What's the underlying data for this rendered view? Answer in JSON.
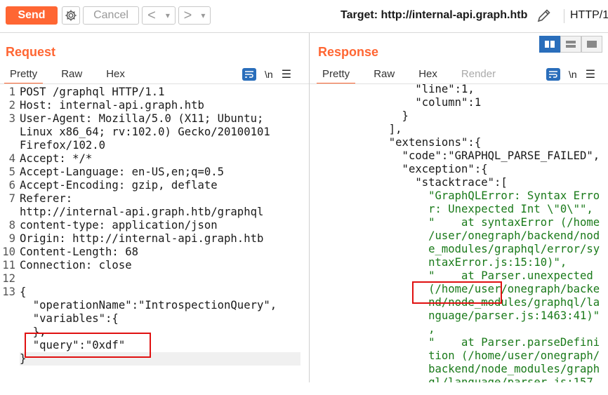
{
  "toolbar": {
    "send_label": "Send",
    "cancel_label": "Cancel",
    "back_label": "<",
    "forward_label": ">",
    "dropdown_glyph": "▾",
    "target_label": "Target: http://internal-api.graph.htb",
    "protocol_label": "HTTP/1"
  },
  "request": {
    "title": "Request",
    "tabs": [
      "Pretty",
      "Raw",
      "Hex"
    ],
    "newline_toggle": "\\n",
    "lines": [
      {
        "n": "1",
        "text": "POST /graphql HTTP/1.1"
      },
      {
        "n": "2",
        "text": "Host: internal-api.graph.htb"
      },
      {
        "n": "3",
        "text": "User-Agent: Mozilla/5.0 (X11; Ubuntu;"
      },
      {
        "n": "",
        "text": "Linux x86_64; rv:102.0) Gecko/20100101"
      },
      {
        "n": "",
        "text": "Firefox/102.0"
      },
      {
        "n": "4",
        "text": "Accept: */*"
      },
      {
        "n": "5",
        "text": "Accept-Language: en-US,en;q=0.5"
      },
      {
        "n": "6",
        "text": "Accept-Encoding: gzip, deflate"
      },
      {
        "n": "7",
        "text": "Referer:"
      },
      {
        "n": "",
        "text": "http://internal-api.graph.htb/graphql"
      },
      {
        "n": "8",
        "text": "content-type: application/json"
      },
      {
        "n": "9",
        "text": "Origin: http://internal-api.graph.htb"
      },
      {
        "n": "10",
        "text": "Content-Length: 68"
      },
      {
        "n": "11",
        "text": "Connection: close"
      },
      {
        "n": "12",
        "text": ""
      },
      {
        "n": "13",
        "text": "{"
      },
      {
        "n": "",
        "text": "  \"operationName\":\"IntrospectionQuery\","
      },
      {
        "n": "",
        "text": "  \"variables\":{"
      },
      {
        "n": "",
        "text": "  },"
      },
      {
        "n": "",
        "text": "  \"query\":\"0xdf\""
      },
      {
        "n": "",
        "text": "}"
      }
    ]
  },
  "response": {
    "title": "Response",
    "tabs": [
      "Pretty",
      "Raw",
      "Hex",
      "Render"
    ],
    "newline_toggle": "\\n",
    "lines": [
      {
        "text": "      \"line\":1,"
      },
      {
        "text": "      \"column\":1"
      },
      {
        "text": "    }"
      },
      {
        "text": "  ],"
      },
      {
        "text": "  \"extensions\":{"
      },
      {
        "text": "    \"code\":\"GRAPHQL_PARSE_FAILED\","
      },
      {
        "text": "    \"exception\":{"
      },
      {
        "text": "      \"stacktrace\":["
      },
      {
        "text": "        \"GraphQLError: Syntax Erro"
      },
      {
        "text": "        r: Unexpected Int \\\"0\\\"\","
      },
      {
        "text": "        \"    at syntaxError (/home"
      },
      {
        "text": "        /user/onegraph/backend/nod"
      },
      {
        "text": "        e_modules/graphql/error/sy"
      },
      {
        "text": "        ntaxError.js:15:10)\","
      },
      {
        "text": "        \"    at Parser.unexpected"
      },
      {
        "text": "        (/home/user/onegraph/backe"
      },
      {
        "text": "        nd/node_modules/graphql/la"
      },
      {
        "text": "        nguage/parser.js:1463:41)\""
      },
      {
        "text": "        ,"
      },
      {
        "text": "        \"    at Parser.parseDefini"
      },
      {
        "text": "        tion (/home/user/onegraph/"
      },
      {
        "text": "        backend/node_modules/graph"
      },
      {
        "text": "        ql/language/parser.js:157"
      }
    ]
  },
  "colors": {
    "accent": "#ff6633",
    "highlight_box": "#e01010",
    "toggle_active": "#2a6ebb"
  }
}
